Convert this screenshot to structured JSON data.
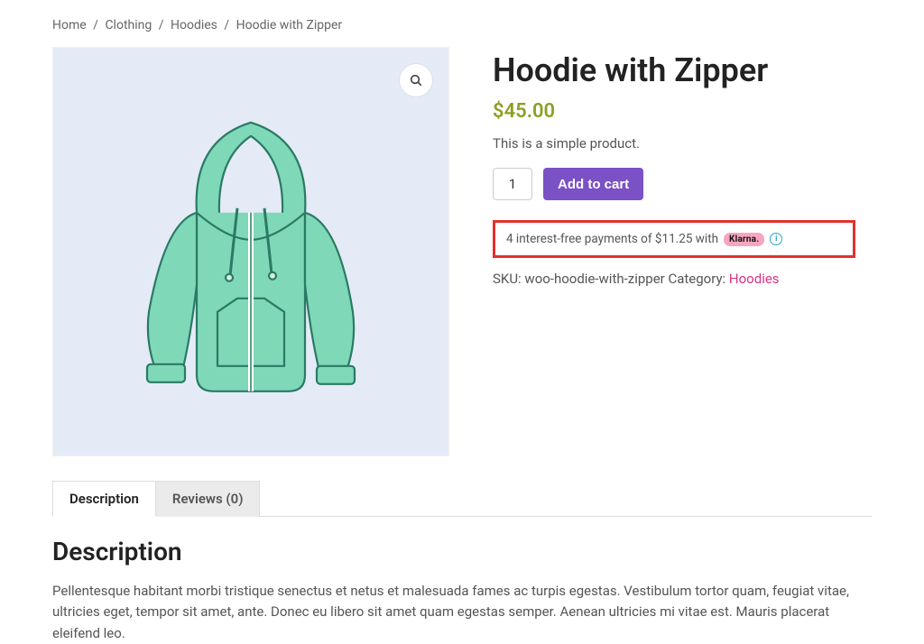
{
  "breadcrumb": {
    "items": [
      "Home",
      "Clothing",
      "Hoodies"
    ],
    "current": "Hoodie with Zipper",
    "sep": "/"
  },
  "product": {
    "title": "Hoodie with Zipper",
    "price": "$45.00",
    "short_description": "This is a simple product.",
    "qty_value": "1",
    "add_to_cart_label": "Add to cart"
  },
  "klarna": {
    "text": "4 interest-free payments of $11.25 with",
    "brand": "Klarna."
  },
  "meta": {
    "sku_label": "SKU:",
    "sku_value": "woo-hoodie-with-zipper",
    "category_label": "Category:",
    "category_value": "Hoodies"
  },
  "tabs": {
    "description_label": "Description",
    "reviews_label": "Reviews (0)"
  },
  "panel": {
    "heading": "Description",
    "body": "Pellentesque habitant morbi tristique senectus et netus et malesuada fames ac turpis egestas. Vestibulum tortor quam, feugiat vitae, ultricies eget, tempor sit amet, ante. Donec eu libero sit amet quam egestas semper. Aenean ultricies mi vitae est. Mauris placerat eleifend leo."
  },
  "icons": {
    "zoom": "search-icon",
    "info": "info-icon"
  },
  "colors": {
    "accent": "#7b51c6",
    "price": "#8f9e25",
    "link": "#d63384",
    "highlight_border": "#e0322b"
  }
}
